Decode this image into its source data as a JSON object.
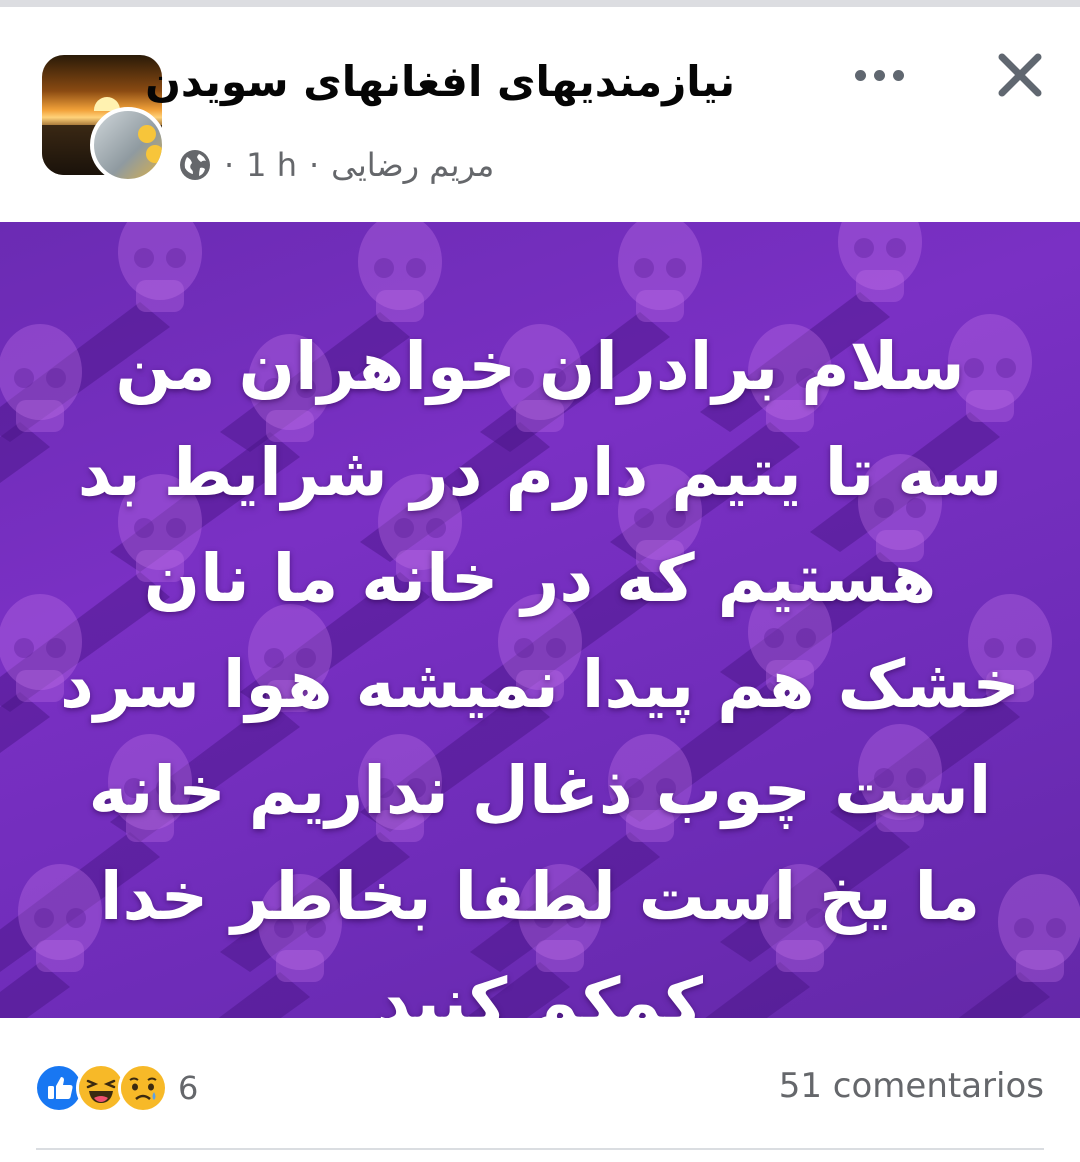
{
  "post": {
    "group_name": "نیازمندیهای افغانهای سویدن",
    "author": "مریم رضایی",
    "time": "1 h",
    "separator": "·",
    "audience_icon": "globe-icon",
    "more_icon": "more-horizontal-icon",
    "close_icon": "close-icon",
    "image_text": "سلام برادران خواهران من سه تا یتیم دارم در شرایط بد هستیم که در خانه ما نان خشک هم پیدا نمیشه هوا سرد است چوب ذغال نداریم خانه ما یخ است لطفا بخاطر خدا کمکم کنید",
    "image_background_color": "#6e2cb8"
  },
  "footer": {
    "reaction_icons": [
      "like-icon",
      "haha-icon",
      "sad-icon"
    ],
    "reaction_count": "6",
    "comments": "51 comentarios"
  },
  "colors": {
    "secondary_text": "#65676b",
    "like_blue": "#1877f2",
    "emoji_yellow": "#f7b928"
  }
}
